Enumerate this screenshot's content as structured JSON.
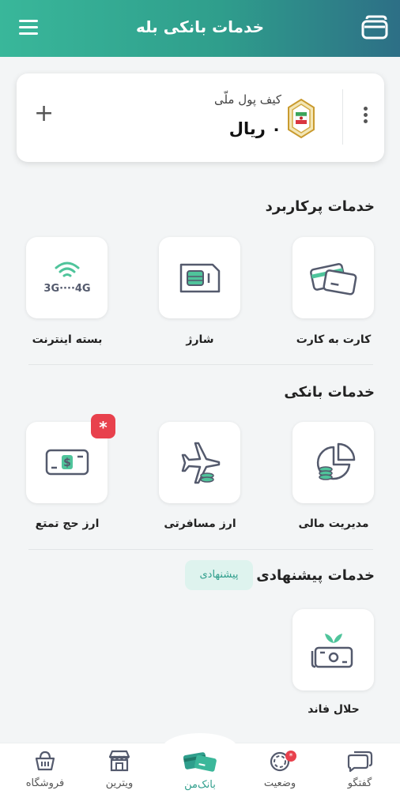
{
  "header": {
    "title": "خدمات بانکی بله",
    "menu_icon": "hamburger-icon",
    "cards_icon": "cards-icon"
  },
  "wallet": {
    "title": "کیف پول ملّی",
    "balance": "۰ ریال",
    "add_symbol": "+",
    "bank_logo": "bank-melli-emblem"
  },
  "sections": {
    "popular": {
      "title": "خدمات پرکاربرد",
      "items": [
        {
          "label": "کارت به کارت",
          "icon": "card-to-card-icon"
        },
        {
          "label": "شارژ",
          "icon": "sim-card-icon"
        },
        {
          "label": "بسته اینترنت",
          "icon": "internet-package-icon",
          "icon_text": "3G····4G"
        }
      ]
    },
    "banking": {
      "title": "خدمات بانکی",
      "items": [
        {
          "label": "مدیریت مالی",
          "icon": "pie-chart-coins-icon"
        },
        {
          "label": "ارز مسافرتی",
          "icon": "airplane-coins-icon"
        },
        {
          "label": "ارز حج تمتع",
          "icon": "banknote-icon",
          "badge": "*"
        }
      ]
    },
    "suggested": {
      "title": "خدمات پیشنهادی",
      "tag": "پیشنهادی",
      "items": [
        {
          "label": "حلال فاند",
          "icon": "halal-fund-icon"
        }
      ]
    }
  },
  "bottom_nav": {
    "items": [
      {
        "label": "فروشگاه",
        "icon": "basket-icon"
      },
      {
        "label": "ویترین",
        "icon": "storefront-icon"
      },
      {
        "label": "بانک‌من",
        "icon": "bank-cards-icon",
        "active": true
      },
      {
        "label": "وضعیت",
        "icon": "status-icon",
        "badge": "*"
      },
      {
        "label": "گفتگو",
        "icon": "chat-icon"
      }
    ]
  },
  "colors": {
    "brand_green": "#2f9e8c",
    "accent_red": "#e8414d",
    "header_gradient_start": "#39b79a",
    "header_gradient_end": "#2d6f86"
  }
}
